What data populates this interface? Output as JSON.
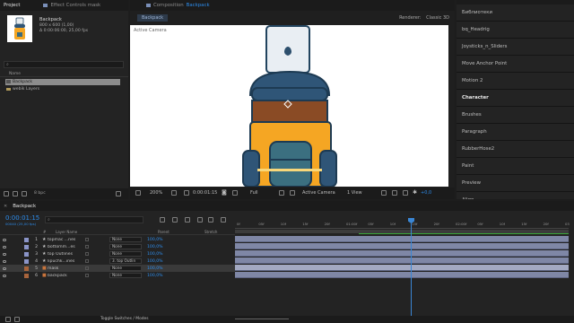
{
  "project": {
    "tab_label": "Project",
    "effect_controls_label": "Effect Controls mask",
    "item_name": "Backpack",
    "item_size": "800 x 600 (1,00)",
    "item_duration": "Δ 0:00:06:00, 25,00 fps",
    "search_placeholder": "",
    "column_name": "Name",
    "list": [
      {
        "name": "Backpack",
        "selected": true
      },
      {
        "name": "webik Layers",
        "selected": false
      }
    ],
    "bpc": "8 bpc"
  },
  "composition": {
    "tab_label": "Composition",
    "tab_comp_name": "Backpack",
    "viewer_tab": "Backpack",
    "renderer_label": "Renderer:",
    "renderer_value": "Classic 3D",
    "active_camera_overlay": "Active Camera",
    "zoom": "200%",
    "timecode": "0:00:01:15",
    "resolution": "Full",
    "camera": "Active Camera",
    "views": "1 View",
    "exposure": "+0,0"
  },
  "right_panel": {
    "items": [
      {
        "label": "Библиотеки",
        "highlight": false
      },
      {
        "label": "bq_Headrig",
        "highlight": false
      },
      {
        "label": "Joysticks_n_Sliders",
        "highlight": false
      },
      {
        "label": "Move Anchor Point",
        "highlight": false
      },
      {
        "label": "Motion 2",
        "highlight": false
      },
      {
        "label": "Character",
        "highlight": true
      },
      {
        "label": "Brushes",
        "highlight": false
      },
      {
        "label": "Paragraph",
        "highlight": false
      },
      {
        "label": "RubberHose2",
        "highlight": false
      },
      {
        "label": "Paint",
        "highlight": false
      },
      {
        "label": "Preview",
        "highlight": false
      },
      {
        "label": "Align",
        "highlight": false
      }
    ]
  },
  "timeline": {
    "tab_label": "Backpack",
    "timecode": "0:00:01:15",
    "frames": "00040 (25,00 fps)",
    "headers": {
      "num": "#",
      "layer_name": "Layer Name",
      "parent": "Parent",
      "stretch": "Stretch"
    },
    "layers": [
      {
        "num": "1",
        "name": "topmac ...nes",
        "parent": "None",
        "stretch": "100,0%",
        "color": "#8a94c8",
        "selected": false
      },
      {
        "num": "2",
        "name": "bottomm...es",
        "parent": "None",
        "stretch": "100,0%",
        "color": "#8a94c8",
        "selected": false
      },
      {
        "num": "3",
        "name": "top Outlines",
        "parent": "None",
        "stretch": "100,0%",
        "color": "#8a94c8",
        "selected": false
      },
      {
        "num": "4",
        "name": "lipuchk...ines",
        "parent": "3. top Outlin",
        "stretch": "100,0%",
        "color": "#8a94c8",
        "selected": false
      },
      {
        "num": "5",
        "name": "mask",
        "parent": "None",
        "stretch": "100,0%",
        "color": "#a8643c",
        "selected": true
      },
      {
        "num": "6",
        "name": "backpack",
        "parent": "None",
        "stretch": "100,0%",
        "color": "#a8643c",
        "selected": false
      }
    ],
    "ruler": [
      "0f",
      "05f",
      "10f",
      "15f",
      "20f",
      "01:00f",
      "05f",
      "10f",
      "15f",
      "20f",
      "02:00f",
      "05f",
      "10f",
      "15f",
      "20f",
      "03"
    ],
    "toggle_label": "Toggle Switches / Modes"
  }
}
